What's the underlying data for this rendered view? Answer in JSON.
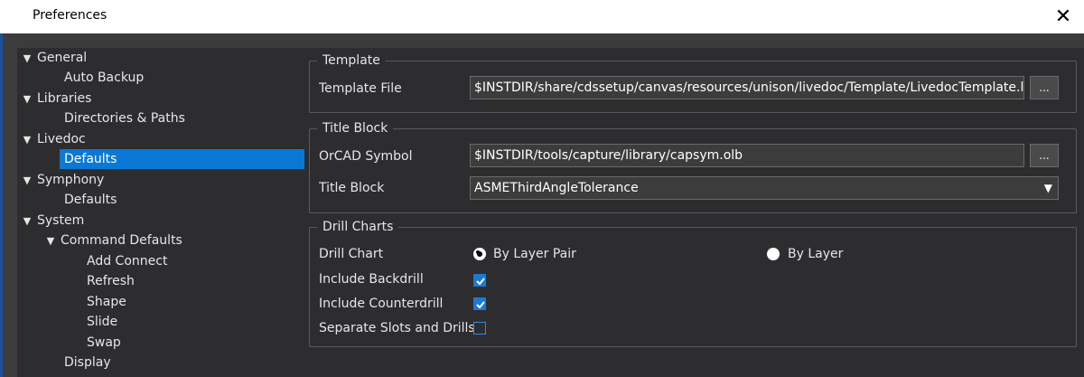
{
  "window": {
    "title": "Preferences",
    "close_glyph": "✕"
  },
  "nav": {
    "items": [
      {
        "label": "General",
        "expanded": true
      },
      {
        "label": "Auto Backup"
      },
      {
        "label": "Libraries",
        "expanded": true
      },
      {
        "label": "Directories & Paths"
      },
      {
        "label": "Livedoc",
        "expanded": true
      },
      {
        "label": "Defaults",
        "selected": true
      },
      {
        "label": "Symphony",
        "expanded": true
      },
      {
        "label": "Defaults"
      },
      {
        "label": "System",
        "expanded": true
      },
      {
        "label": "Command Defaults",
        "expanded": true
      },
      {
        "label": "Add Connect"
      },
      {
        "label": "Refresh"
      },
      {
        "label": "Shape"
      },
      {
        "label": "Slide"
      },
      {
        "label": "Swap"
      },
      {
        "label": "Display"
      }
    ]
  },
  "template": {
    "group_title": "Template",
    "file_label": "Template File",
    "file_value": "$INSTDIR/share/cdssetup/canvas/resources/unison/livedoc/Template/LivedocTemplate.ldt",
    "browse_label": "..."
  },
  "title_block": {
    "group_title": "Title Block",
    "symbol_label": "OrCAD Symbol",
    "symbol_value": "$INSTDIR/tools/capture/library/capsym.olb",
    "browse_label": "...",
    "block_label": "Title Block",
    "block_value": "ASMEThirdAngleTolerance"
  },
  "drill_charts": {
    "group_title": "Drill Charts",
    "chart_label": "Drill Chart",
    "option_layer_pair": "By Layer Pair",
    "option_layer": "By Layer",
    "selected_option": "By Layer Pair",
    "backdrill_label": "Include Backdrill",
    "backdrill_checked": true,
    "counterdrill_label": "Include Counterdrill",
    "counterdrill_checked": true,
    "separate_label": "Separate Slots and Drills",
    "separate_checked": false
  },
  "colors": {
    "selection": "#0a78d4",
    "panel": "#2d2d30",
    "checkbox": "#1b79d6"
  },
  "icons": {
    "expand": "triangle-down-icon",
    "close": "close-icon",
    "dropdown": "chevron-down-icon"
  }
}
